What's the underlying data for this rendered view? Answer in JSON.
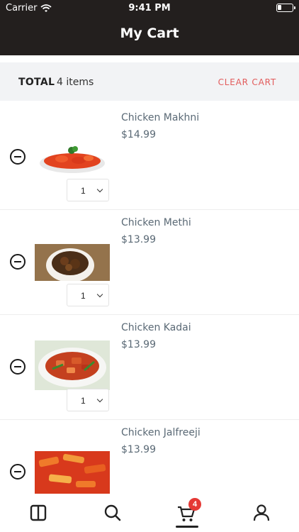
{
  "status_bar": {
    "carrier": "Carrier",
    "time": "9:41 PM"
  },
  "header": {
    "title": "My Cart"
  },
  "total_bar": {
    "label": "TOTAL",
    "count": "4 items",
    "clear_label": "CLEAR CART"
  },
  "items": [
    {
      "name": "Chicken Makhni",
      "price": "$14.99",
      "quantity": "1"
    },
    {
      "name": "Chicken Methi",
      "price": "$13.99",
      "quantity": "1"
    },
    {
      "name": "Chicken Kadai",
      "price": "$13.99",
      "quantity": "1"
    },
    {
      "name": "Chicken Jalfreeji",
      "price": "$13.99"
    }
  ],
  "tab_bar": {
    "tabs": [
      "menu-icon",
      "search-icon",
      "cart-icon",
      "profile-icon"
    ],
    "cart_badge": "4",
    "active": "cart-icon"
  },
  "colors": {
    "header_bg": "#231f1e",
    "accent_red": "#e25b5b",
    "badge_red": "#e53935",
    "text_gray": "#5a6975"
  }
}
